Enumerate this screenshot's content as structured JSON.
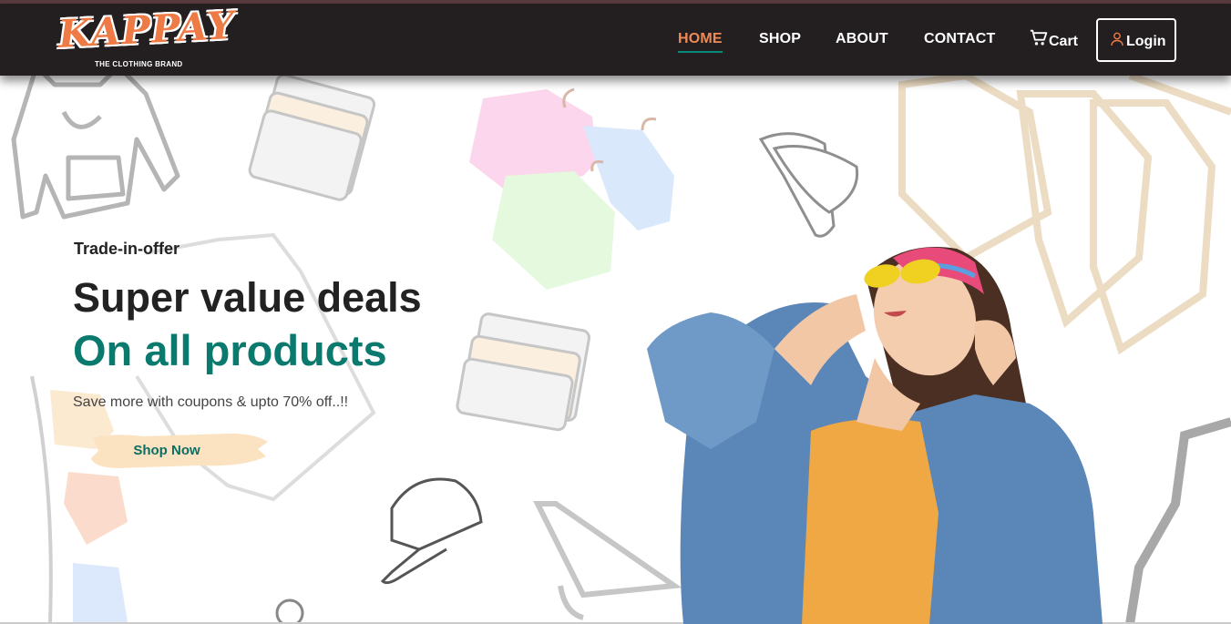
{
  "brand": {
    "name": "KAPPAY",
    "tagline": "THE CLOTHING BRAND",
    "accent_color": "#ee7a45",
    "nav_bg": "#231f20",
    "teal_color": "#0b7a6e"
  },
  "nav": {
    "items": [
      {
        "label": "HOME",
        "active": true
      },
      {
        "label": "SHOP",
        "active": false
      },
      {
        "label": "ABOUT",
        "active": false
      },
      {
        "label": "CONTACT",
        "active": false
      }
    ],
    "cart_label": "Cart",
    "cart_icon": "shopping-cart-icon",
    "login_label": "Login",
    "login_icon": "user-icon"
  },
  "hero": {
    "eyebrow": "Trade-in-offer",
    "headline": "Super value deals",
    "subheadline": "On all products",
    "blurb": "Save more with coupons & upto 70% off..!!",
    "cta_label": "Shop Now"
  }
}
